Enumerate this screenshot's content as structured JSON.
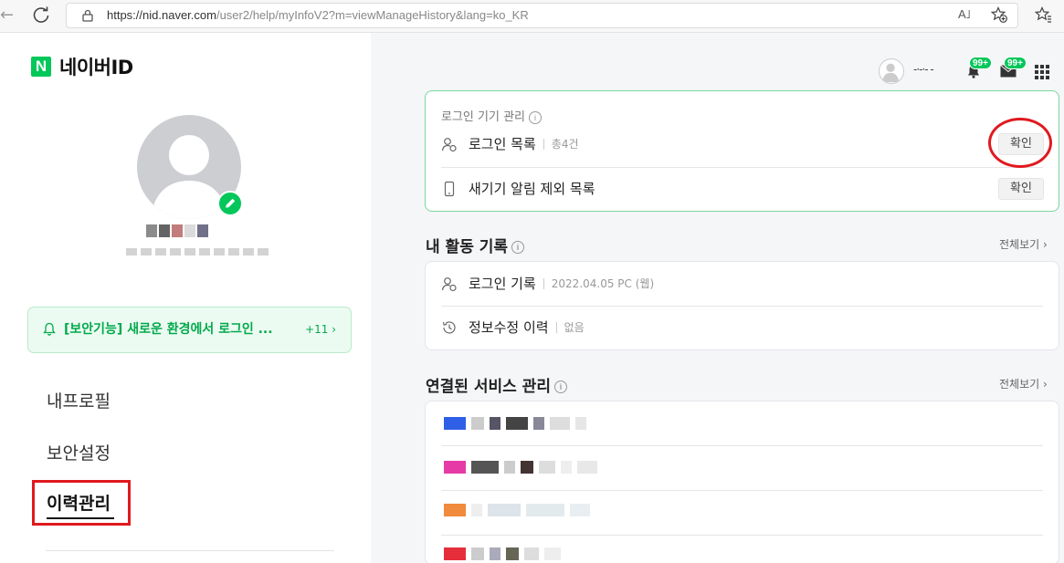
{
  "browser": {
    "url_host": "https://nid.naver.com",
    "url_path": "/user2/help/myInfoV2?m=viewManageHistory&lang=ko_KR",
    "reader_label": "A˩"
  },
  "logo": {
    "letter": "N",
    "text": "네이버ID"
  },
  "notice": {
    "text": "[보안기능] 새로운 환경에서 로그인 ...",
    "count": "+11 ›"
  },
  "menu": {
    "profile": "내프로필",
    "security": "보안설정",
    "history": "이력관리"
  },
  "topbar": {
    "name": "-·-·- -",
    "bell_badge": "99+",
    "mail_badge": "99+"
  },
  "device_card": {
    "title": "로그인 기기 관리",
    "rows": [
      {
        "label": "로그인 목록",
        "meta": "총4건",
        "button": "확인"
      },
      {
        "label": "새기기 알림 제외 목록",
        "button": "확인"
      }
    ]
  },
  "activity": {
    "title": "내 활동 기록",
    "view_all": "전체보기 ›",
    "rows": [
      {
        "label": "로그인 기록",
        "meta": "2022.04.05 PC (웹)"
      },
      {
        "label": "정보수정 이력",
        "meta": "없음"
      }
    ]
  },
  "services": {
    "title": "연결된 서비스 관리",
    "view_all": "전체보기 ›"
  },
  "info_glyph": "i",
  "colors": {
    "brand_green": "#03c75a",
    "highlight_red": "#e0191f"
  }
}
